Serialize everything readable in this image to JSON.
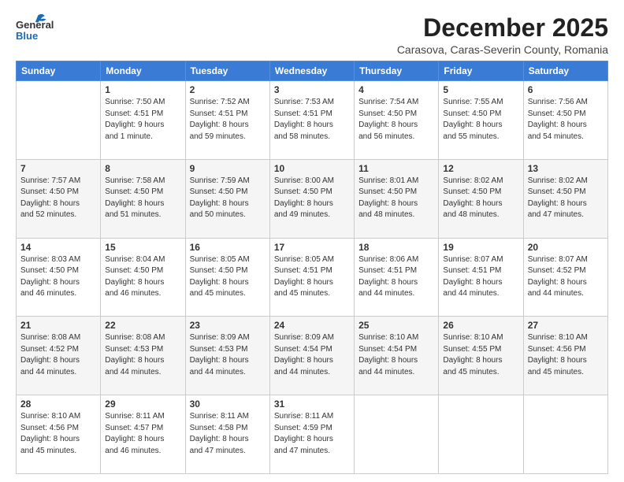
{
  "header": {
    "logo_general": "General",
    "logo_blue": "Blue",
    "month_title": "December 2025",
    "subtitle": "Carasova, Caras-Severin County, Romania"
  },
  "weekdays": [
    "Sunday",
    "Monday",
    "Tuesday",
    "Wednesday",
    "Thursday",
    "Friday",
    "Saturday"
  ],
  "weeks": [
    [
      {
        "day": "",
        "info": ""
      },
      {
        "day": "1",
        "info": "Sunrise: 7:50 AM\nSunset: 4:51 PM\nDaylight: 9 hours\nand 1 minute."
      },
      {
        "day": "2",
        "info": "Sunrise: 7:52 AM\nSunset: 4:51 PM\nDaylight: 8 hours\nand 59 minutes."
      },
      {
        "day": "3",
        "info": "Sunrise: 7:53 AM\nSunset: 4:51 PM\nDaylight: 8 hours\nand 58 minutes."
      },
      {
        "day": "4",
        "info": "Sunrise: 7:54 AM\nSunset: 4:50 PM\nDaylight: 8 hours\nand 56 minutes."
      },
      {
        "day": "5",
        "info": "Sunrise: 7:55 AM\nSunset: 4:50 PM\nDaylight: 8 hours\nand 55 minutes."
      },
      {
        "day": "6",
        "info": "Sunrise: 7:56 AM\nSunset: 4:50 PM\nDaylight: 8 hours\nand 54 minutes."
      }
    ],
    [
      {
        "day": "7",
        "info": "Sunrise: 7:57 AM\nSunset: 4:50 PM\nDaylight: 8 hours\nand 52 minutes."
      },
      {
        "day": "8",
        "info": "Sunrise: 7:58 AM\nSunset: 4:50 PM\nDaylight: 8 hours\nand 51 minutes."
      },
      {
        "day": "9",
        "info": "Sunrise: 7:59 AM\nSunset: 4:50 PM\nDaylight: 8 hours\nand 50 minutes."
      },
      {
        "day": "10",
        "info": "Sunrise: 8:00 AM\nSunset: 4:50 PM\nDaylight: 8 hours\nand 49 minutes."
      },
      {
        "day": "11",
        "info": "Sunrise: 8:01 AM\nSunset: 4:50 PM\nDaylight: 8 hours\nand 48 minutes."
      },
      {
        "day": "12",
        "info": "Sunrise: 8:02 AM\nSunset: 4:50 PM\nDaylight: 8 hours\nand 48 minutes."
      },
      {
        "day": "13",
        "info": "Sunrise: 8:02 AM\nSunset: 4:50 PM\nDaylight: 8 hours\nand 47 minutes."
      }
    ],
    [
      {
        "day": "14",
        "info": "Sunrise: 8:03 AM\nSunset: 4:50 PM\nDaylight: 8 hours\nand 46 minutes."
      },
      {
        "day": "15",
        "info": "Sunrise: 8:04 AM\nSunset: 4:50 PM\nDaylight: 8 hours\nand 46 minutes."
      },
      {
        "day": "16",
        "info": "Sunrise: 8:05 AM\nSunset: 4:50 PM\nDaylight: 8 hours\nand 45 minutes."
      },
      {
        "day": "17",
        "info": "Sunrise: 8:05 AM\nSunset: 4:51 PM\nDaylight: 8 hours\nand 45 minutes."
      },
      {
        "day": "18",
        "info": "Sunrise: 8:06 AM\nSunset: 4:51 PM\nDaylight: 8 hours\nand 44 minutes."
      },
      {
        "day": "19",
        "info": "Sunrise: 8:07 AM\nSunset: 4:51 PM\nDaylight: 8 hours\nand 44 minutes."
      },
      {
        "day": "20",
        "info": "Sunrise: 8:07 AM\nSunset: 4:52 PM\nDaylight: 8 hours\nand 44 minutes."
      }
    ],
    [
      {
        "day": "21",
        "info": "Sunrise: 8:08 AM\nSunset: 4:52 PM\nDaylight: 8 hours\nand 44 minutes."
      },
      {
        "day": "22",
        "info": "Sunrise: 8:08 AM\nSunset: 4:53 PM\nDaylight: 8 hours\nand 44 minutes."
      },
      {
        "day": "23",
        "info": "Sunrise: 8:09 AM\nSunset: 4:53 PM\nDaylight: 8 hours\nand 44 minutes."
      },
      {
        "day": "24",
        "info": "Sunrise: 8:09 AM\nSunset: 4:54 PM\nDaylight: 8 hours\nand 44 minutes."
      },
      {
        "day": "25",
        "info": "Sunrise: 8:10 AM\nSunset: 4:54 PM\nDaylight: 8 hours\nand 44 minutes."
      },
      {
        "day": "26",
        "info": "Sunrise: 8:10 AM\nSunset: 4:55 PM\nDaylight: 8 hours\nand 45 minutes."
      },
      {
        "day": "27",
        "info": "Sunrise: 8:10 AM\nSunset: 4:56 PM\nDaylight: 8 hours\nand 45 minutes."
      }
    ],
    [
      {
        "day": "28",
        "info": "Sunrise: 8:10 AM\nSunset: 4:56 PM\nDaylight: 8 hours\nand 45 minutes."
      },
      {
        "day": "29",
        "info": "Sunrise: 8:11 AM\nSunset: 4:57 PM\nDaylight: 8 hours\nand 46 minutes."
      },
      {
        "day": "30",
        "info": "Sunrise: 8:11 AM\nSunset: 4:58 PM\nDaylight: 8 hours\nand 47 minutes."
      },
      {
        "day": "31",
        "info": "Sunrise: 8:11 AM\nSunset: 4:59 PM\nDaylight: 8 hours\nand 47 minutes."
      },
      {
        "day": "",
        "info": ""
      },
      {
        "day": "",
        "info": ""
      },
      {
        "day": "",
        "info": ""
      }
    ]
  ]
}
